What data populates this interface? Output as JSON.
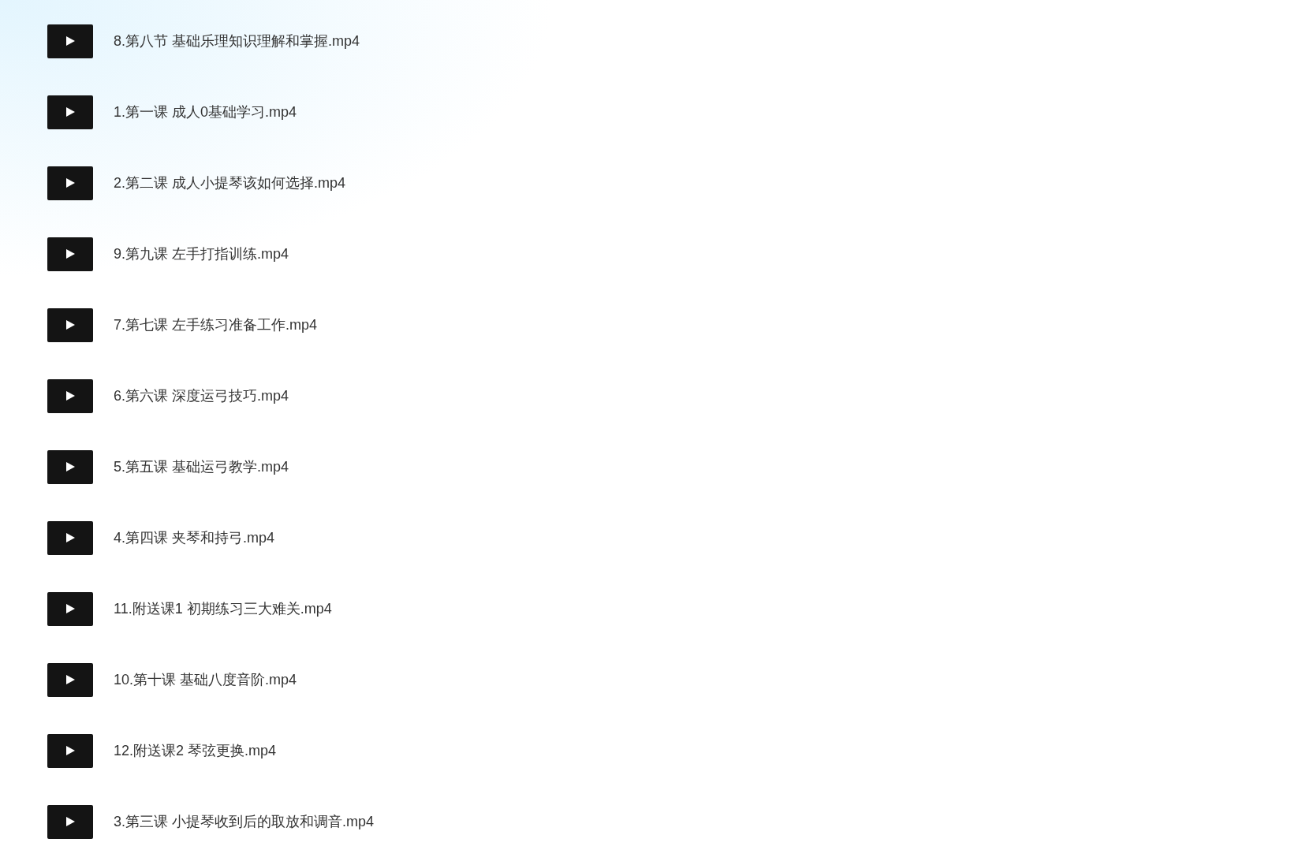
{
  "files": [
    {
      "name": "8.第八节 基础乐理知识理解和掌握.mp4"
    },
    {
      "name": "1.第一课 成人0基础学习.mp4"
    },
    {
      "name": "2.第二课 成人小提琴该如何选择.mp4"
    },
    {
      "name": "9.第九课 左手打指训练.mp4"
    },
    {
      "name": "7.第七课 左手练习准备工作.mp4"
    },
    {
      "name": "6.第六课 深度运弓技巧.mp4"
    },
    {
      "name": "5.第五课 基础运弓教学.mp4"
    },
    {
      "name": "4.第四课 夹琴和持弓.mp4"
    },
    {
      "name": "11.附送课1 初期练习三大难关.mp4"
    },
    {
      "name": "10.第十课 基础八度音阶.mp4"
    },
    {
      "name": "12.附送课2 琴弦更换.mp4"
    },
    {
      "name": "3.第三课 小提琴收到后的取放和调音.mp4"
    }
  ]
}
